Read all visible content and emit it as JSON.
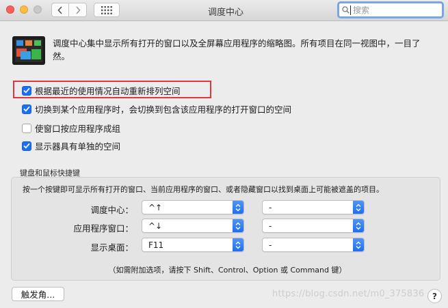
{
  "window": {
    "title": "调度中心",
    "search_placeholder": "搜索"
  },
  "description": "调度中心集中显示所有打开的窗口以及全屏幕应用程序的缩略图。所有项目在同一视图中，一目了然。",
  "options": [
    {
      "label": "根据最近的使用情况自动重新排列空间",
      "checked": true
    },
    {
      "label": "切换到某个应用程序时，会切换到包含该应用程序的打开窗口的空间",
      "checked": true
    },
    {
      "label": "使窗口按应用程序成组",
      "checked": false
    },
    {
      "label": "显示器具有单独的空间",
      "checked": true
    }
  ],
  "shortcuts": {
    "title": "键盘和鼠标快捷键",
    "description": "按一个按键即可显示所有打开的窗口、当前应用程序的窗口、或者隐藏窗口以找到桌面上可能被遮盖的项目。",
    "rows": [
      {
        "label": "调度中心：",
        "key": "^↑",
        "mouse": "-"
      },
      {
        "label": "应用程序窗口：",
        "key": "^↓",
        "mouse": "-"
      },
      {
        "label": "显示桌面：",
        "key": "F11",
        "mouse": "-"
      }
    ],
    "hint": "（如需附加选项，请按下 Shift、Control、Option 或 Command 键）"
  },
  "buttons": {
    "hot_corners": "触发角...",
    "help": "?"
  },
  "watermark": "https://blog.csdn.net/m0_375836",
  "colors": {
    "accent": "#1a6ff2",
    "highlight_box": "#e0373f"
  }
}
